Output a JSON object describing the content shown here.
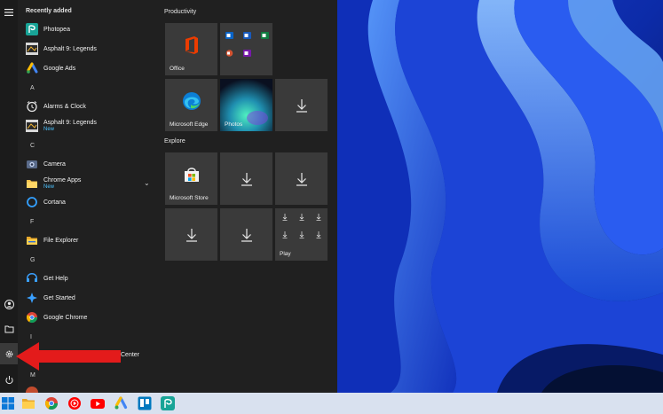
{
  "start_menu": {
    "recently_added_title": "Recently added",
    "apps": [
      {
        "type": "app",
        "name": "Photopea",
        "icon": "photopea-icon"
      },
      {
        "type": "app",
        "name": "Asphalt 9: Legends",
        "icon": "asphalt-icon"
      },
      {
        "type": "app",
        "name": "Google Ads",
        "icon": "google-ads-icon"
      },
      {
        "type": "letter",
        "name": "A"
      },
      {
        "type": "app",
        "name": "Alarms & Clock",
        "icon": "alarm-clock-icon"
      },
      {
        "type": "app",
        "name": "Asphalt 9: Legends",
        "badge": "New",
        "icon": "asphalt-icon"
      },
      {
        "type": "letter",
        "name": "C"
      },
      {
        "type": "app",
        "name": "Camera",
        "icon": "camera-icon"
      },
      {
        "type": "app",
        "name": "Chrome Apps",
        "badge": "New",
        "icon": "folder-icon"
      },
      {
        "type": "app",
        "name": "Cortana",
        "icon": "cortana-icon"
      },
      {
        "type": "letter",
        "name": "F"
      },
      {
        "type": "app",
        "name": "File Explorer",
        "icon": "file-explorer-icon"
      },
      {
        "type": "letter",
        "name": "G"
      },
      {
        "type": "app",
        "name": "Get Help",
        "icon": "get-help-icon"
      },
      {
        "type": "app",
        "name": "Get Started",
        "icon": "get-started-icon"
      },
      {
        "type": "app",
        "name": "Google Chrome",
        "icon": "chrome-icon"
      },
      {
        "type": "letter",
        "name": "I"
      },
      {
        "type": "app",
        "name": "Center",
        "icon": "app-icon"
      },
      {
        "type": "letter",
        "name": "M"
      }
    ],
    "groups": {
      "productivity": "Productivity",
      "explore": "Explore"
    },
    "tiles": {
      "office": "Office",
      "edge": "Microsoft Edge",
      "photos": "Photos",
      "store": "Microsoft Store",
      "play": "Play"
    }
  },
  "rail": {
    "icons": [
      "hamburger-menu-icon",
      "user-icon",
      "documents-icon",
      "settings-gear-icon",
      "power-icon"
    ]
  },
  "taskbar": {
    "icons": [
      "windows-start-icon",
      "file-explorer-icon",
      "chrome-icon",
      "youtube-music-icon",
      "youtube-icon",
      "google-ads-icon",
      "trello-icon",
      "photopea-icon"
    ]
  },
  "colors": {
    "menu_bg": "#202020",
    "tile_bg": "#3a3a3a",
    "accent": "#4cc2ff",
    "arrow": "#e31b1b",
    "taskbar": "#d9e1ef"
  }
}
